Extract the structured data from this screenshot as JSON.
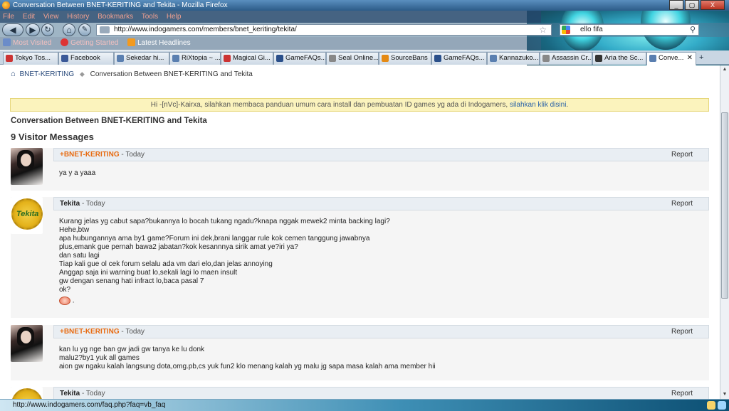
{
  "window": {
    "title": "Conversation Between BNET-KERITING and Tekita - Mozilla Firefox",
    "buttons": [
      "_",
      "▢",
      "X"
    ]
  },
  "menu": [
    "File",
    "Edit",
    "View",
    "History",
    "Bookmarks",
    "Tools",
    "Help"
  ],
  "nav": {
    "url": "http://www.indogamers.com/members/bnet_keriting/tekita/",
    "search_value": "ello fifa"
  },
  "bookmarks": [
    "Most Visited",
    "Getting Started",
    "Latest Headlines"
  ],
  "tabs": [
    {
      "label": "Tokyo Tos...",
      "color": "#c33"
    },
    {
      "label": "Facebook",
      "color": "#3b5998"
    },
    {
      "label": "Sekedar hi...",
      "color": "#5a7fb0"
    },
    {
      "label": "RiXtopia ~ ...",
      "color": "#5a7fb0"
    },
    {
      "label": "Magical Gi...",
      "color": "#c33"
    },
    {
      "label": "GameFAQs...",
      "color": "#2a4f8a"
    },
    {
      "label": "Seal Online...",
      "color": "#888"
    },
    {
      "label": "SourceBans",
      "color": "#e58a14"
    },
    {
      "label": "GameFAQs...",
      "color": "#2a4f8a"
    },
    {
      "label": "Kannazuko...",
      "color": "#5a7fb0"
    },
    {
      "label": "Assassin Cr...",
      "color": "#888"
    },
    {
      "label": "Aria the Sc...",
      "color": "#333"
    },
    {
      "label": "Conve...",
      "color": "#5a7fb0"
    }
  ],
  "page": {
    "breadcrumb": {
      "home": "BNET-KERITING",
      "current": "Conversation Between BNET-KERITING and Tekita"
    },
    "notice": {
      "text": "Hi -[nVc]-Kairxa, silahkan membaca panduan umum cara install dan pembuatan ID games yg ada di Indogamers,",
      "link": "silahkan klik disini",
      "end": "."
    },
    "title": "Conversation Between BNET-KERITING and Tekita",
    "count_heading": "9 Visitor Messages",
    "report_label": "Report",
    "messages": [
      {
        "user": "+BNET-KERITING",
        "when": "- Today",
        "lines": [
          "ya y a yaaa"
        ]
      },
      {
        "user": "Tekita",
        "when": "- Today",
        "lines": [
          "Kurang jelas yg cabut sapa?bukannya lo bocah tukang ngadu?knapa nggak mewek2 minta backing lagi?",
          "Hehe,btw",
          "apa hubungannya ama by1 game?Forum ini dek,brani langgar rule kok cemen tanggung jawabnya",
          "plus,emank gue pernah bawa2 jabatan?kok kesannnya sirik amat ye?iri ya?",
          "dan satu lagi",
          "Tiap kali gue ol cek forum selalu ada vm dari elo,dan jelas annoying",
          "Anggap saja ini warning buat lo,sekali lagi lo maen insult",
          "gw dengan senang hati infract lo,baca pasal 7",
          "ok?"
        ],
        "smiley_suffix": "."
      },
      {
        "user": "+BNET-KERITING",
        "when": "- Today",
        "lines": [
          "kan lu yg nge ban gw jadi gw tanya ke lu donk",
          "malu2?by1 yuk all games",
          "aion gw ngaku kalah langsung dota,omg.pb,cs yuk fun2 klo menang kalah yg malu jg sapa masa kalah ama member hii"
        ]
      },
      {
        "user": "Tekita",
        "when": "- Today",
        "lines": []
      }
    ]
  },
  "status": {
    "text": "http://www.indogamers.com/faq.php?faq=vb_faq"
  }
}
